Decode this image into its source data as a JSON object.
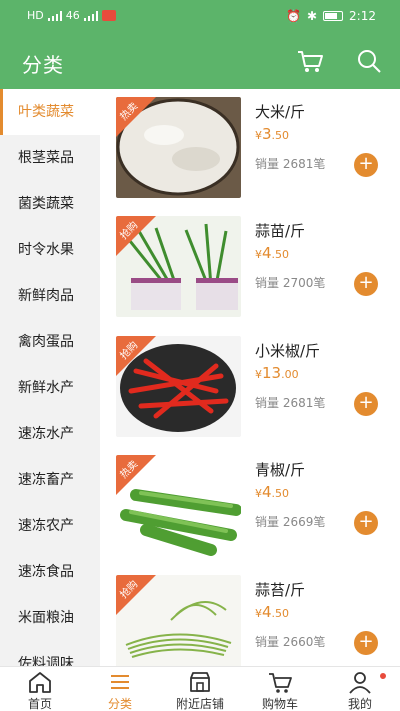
{
  "status": {
    "left_labels": [
      "HD",
      "46",
      "46"
    ],
    "time": "2:12"
  },
  "header": {
    "title": "分类"
  },
  "sidebar": {
    "items": [
      {
        "label": "叶类蔬菜",
        "active": true
      },
      {
        "label": "根茎菜品"
      },
      {
        "label": "菌类蔬菜"
      },
      {
        "label": "时令水果"
      },
      {
        "label": "新鲜肉品"
      },
      {
        "label": "禽肉蛋品"
      },
      {
        "label": "新鲜水产"
      },
      {
        "label": "速冻水产"
      },
      {
        "label": "速冻畜产"
      },
      {
        "label": "速冻农产"
      },
      {
        "label": "速冻食品"
      },
      {
        "label": "米面粮油"
      },
      {
        "label": "佐料调味"
      }
    ]
  },
  "products": [
    {
      "name": "大米/斤",
      "tag": "热卖",
      "currency": "¥",
      "price_int": "3",
      "price_dec": ".50",
      "sales": "销量 2681笔"
    },
    {
      "name": "蒜苗/斤",
      "tag": "抢购",
      "currency": "¥",
      "price_int": "4",
      "price_dec": ".50",
      "sales": "销量 2700笔"
    },
    {
      "name": "小米椒/斤",
      "tag": "抢购",
      "currency": "¥",
      "price_int": "13",
      "price_dec": ".00",
      "sales": "销量 2681笔"
    },
    {
      "name": "青椒/斤",
      "tag": "热卖",
      "currency": "¥",
      "price_int": "4",
      "price_dec": ".50",
      "sales": "销量 2669笔"
    },
    {
      "name": "蒜苔/斤",
      "tag": "抢购",
      "currency": "¥",
      "price_int": "4",
      "price_dec": ".50",
      "sales": "销量 2660笔"
    }
  ],
  "add_label": "+",
  "bottom_nav": [
    {
      "label": "首页"
    },
    {
      "label": "分类",
      "active": true
    },
    {
      "label": "附近店铺"
    },
    {
      "label": "购物车"
    },
    {
      "label": "我的"
    }
  ],
  "colors": {
    "primary": "#5cb46a",
    "accent": "#e38b2f",
    "tag": "#e86b3c"
  }
}
